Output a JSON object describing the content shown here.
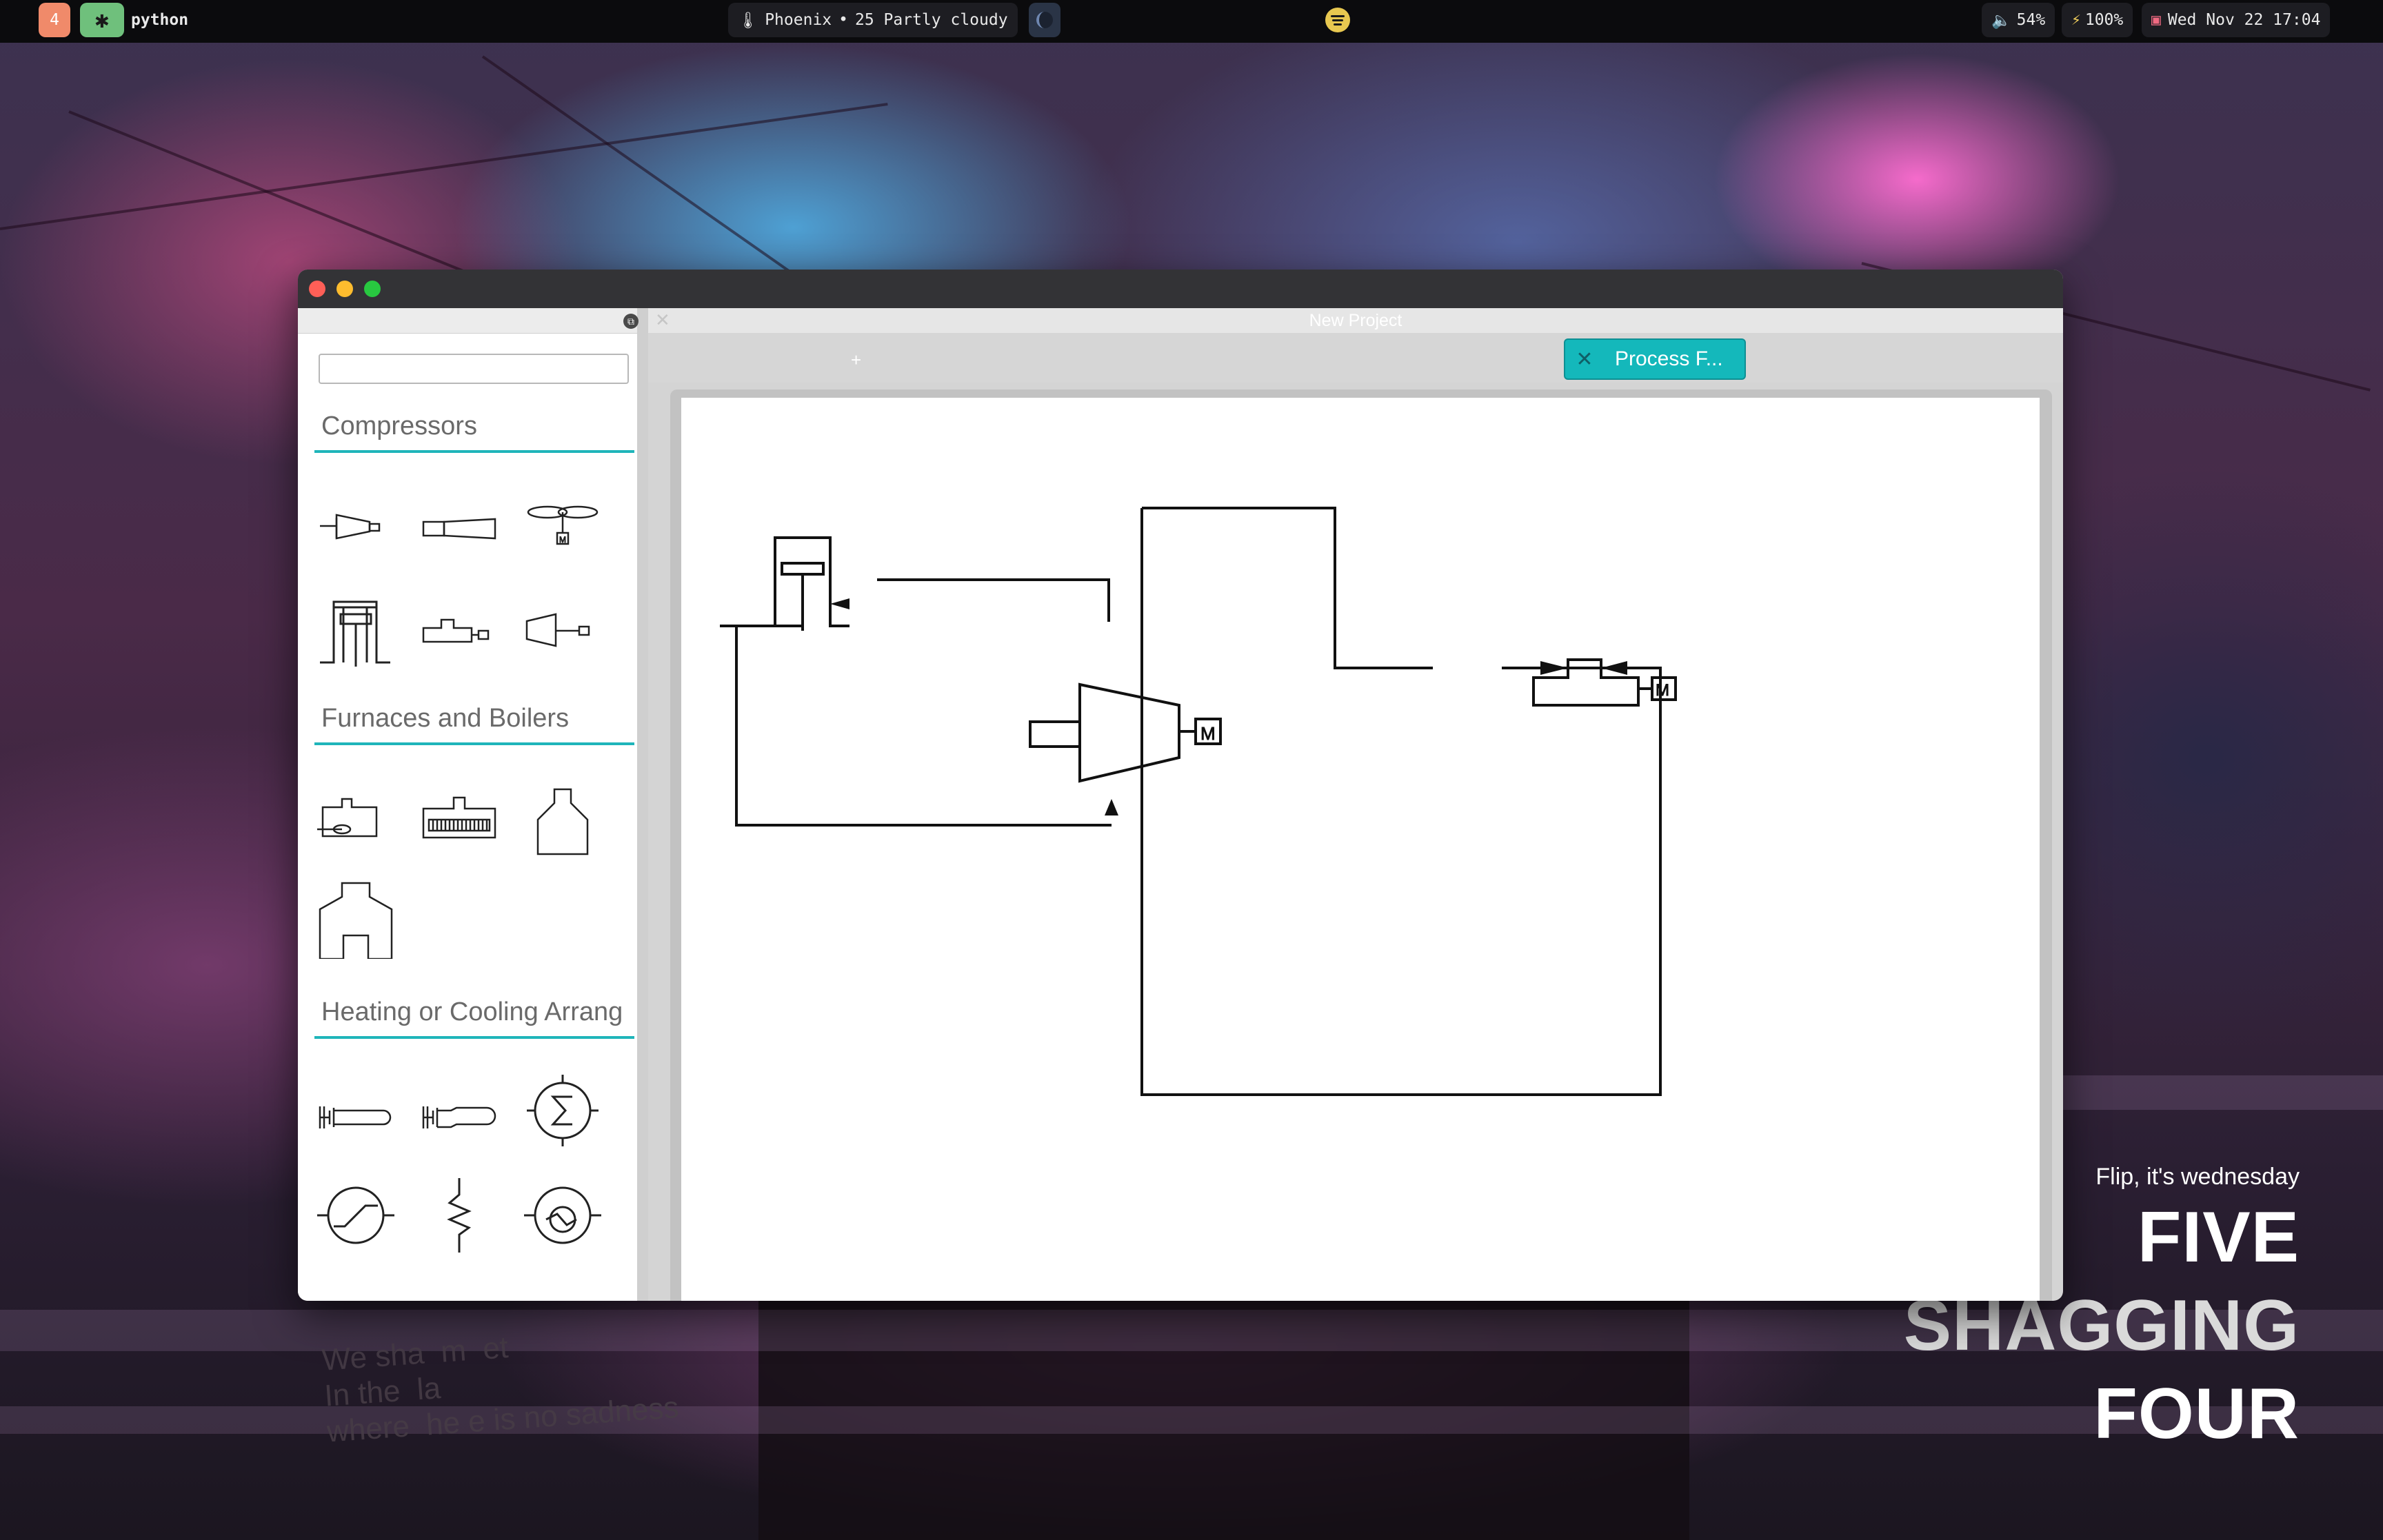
{
  "topbar": {
    "workspace_number": "4",
    "workspace_icon": "✱",
    "active_app": "python",
    "weather_location": "Phoenix",
    "weather_text": "25 Partly cloudy",
    "volume": "54%",
    "battery": "100%",
    "datetime": "Wed Nov 22 17:04"
  },
  "window": {
    "document_title": "New Project",
    "new_tab_label": "+",
    "active_tab_label": "Process F...",
    "tab_close_glyph": "✕",
    "doc_close_glyph": "✕"
  },
  "sidebar": {
    "search_placeholder": "",
    "categories": [
      {
        "title": "Compressors",
        "symbols": [
          "centrifugal-compressor-icon",
          "rotary-compressor-icon",
          "fan-compressor-icon",
          "reciprocating-compressor-icon",
          "screw-compressor-icon",
          "turbine-compressor-icon"
        ]
      },
      {
        "title": "Furnaces and Boilers",
        "symbols": [
          "furnace-icon",
          "heater-coil-icon",
          "boiler-icon",
          "reformer-furnace-icon"
        ]
      },
      {
        "title": "Heating or Cooling Arrang",
        "symbols": [
          "tube-heater-icon",
          "double-pipe-exchanger-icon",
          "heat-exchanger-icon",
          "cooler-icon",
          "coil-icon",
          "condenser-icon"
        ]
      }
    ]
  },
  "diagram": {
    "motor_label": "M"
  },
  "wallpaper": {
    "quote_sub": "Flip, it's wednesday",
    "quote_line1": "FIVE",
    "quote_line2": "SHAGGING",
    "quote_line3": "FOUR",
    "shirt_text": "We sha  m  et\nIn the  la\nwhere  he e is no sadness"
  },
  "colors": {
    "accent": "#1fb5ba",
    "tab_active": "#14b8bb",
    "close": "#ff5f57",
    "minimize": "#febc2e",
    "maximize": "#28c840"
  }
}
